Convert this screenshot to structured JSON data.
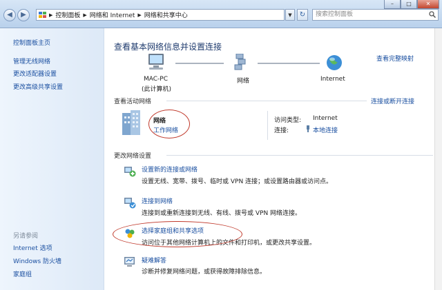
{
  "address_bar": {
    "crumbs": [
      "控制面板",
      "网络和 Internet",
      "网络和共享中心"
    ],
    "search_placeholder": "搜索控制面板"
  },
  "sidebar": {
    "home": "控制面板主页",
    "items": [
      "管理无线网络",
      "更改适配器设置",
      "更改高级共享设置"
    ],
    "see_also_head": "另请参阅",
    "see_also": [
      "Internet 选项",
      "Windows 防火墙",
      "家庭组"
    ]
  },
  "main": {
    "title": "查看基本网络信息并设置连接",
    "full_map": "查看完整映射",
    "map": {
      "pc_name": "MAC-PC",
      "pc_sub": "(此计算机)",
      "network": "网络",
      "internet": "Internet"
    },
    "active_head": "查看活动网络",
    "connect_disconnect": "连接或断开连接",
    "active": {
      "name": "网络",
      "type": "工作网络",
      "access_label": "访问类型:",
      "access_value": "Internet",
      "conn_label": "连接:",
      "conn_value": "本地连接"
    },
    "change_head": "更改网络设置",
    "tasks": [
      {
        "link": "设置新的连接或网络",
        "desc": "设置无线、宽带、拨号、临时或 VPN 连接；或设置路由器或访问点。",
        "icon": "network-setup-icon"
      },
      {
        "link": "连接到网络",
        "desc": "连接到或重新连接到无线、有线、拨号或 VPN 网络连接。",
        "icon": "connect-network-icon"
      },
      {
        "link": "选择家庭组和共享选项",
        "desc": "访问位于其他网络计算机上的文件和打印机，或更改共享设置。",
        "icon": "homegroup-icon"
      },
      {
        "link": "疑难解答",
        "desc": "诊断并修复网络问题，或获得故障排除信息。",
        "icon": "troubleshoot-icon"
      }
    ]
  },
  "colors": {
    "link": "#1a4fa0",
    "annotation": "#c0392b"
  }
}
